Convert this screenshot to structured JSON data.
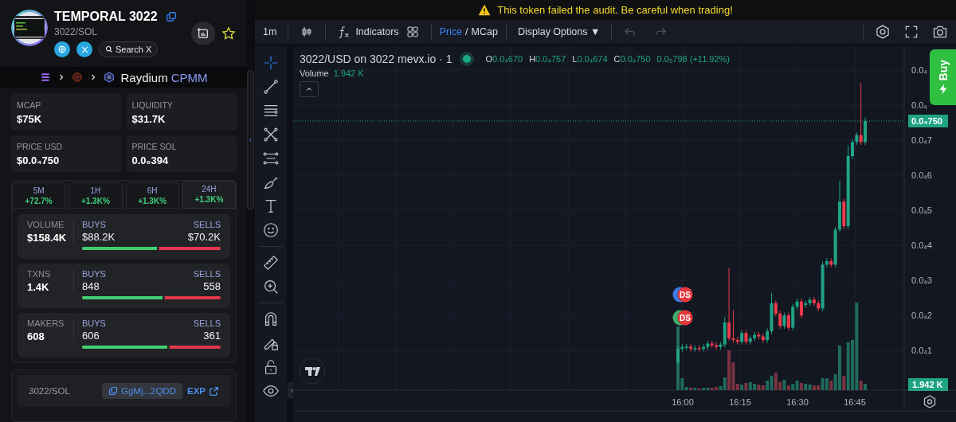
{
  "token": {
    "name": "TEMPORAL 3022",
    "pair": "3022/SOL",
    "search_label": "Search X"
  },
  "breadcrumb": {
    "dex": "Raydium",
    "pool_type": "CPMM"
  },
  "stats": [
    {
      "label": "MCAP",
      "value": "$75K"
    },
    {
      "label": "LIQUIDITY",
      "value": "$31.7K"
    },
    {
      "label": "PRICE USD",
      "value": "$0.0₄750"
    },
    {
      "label": "PRICE SOL",
      "value": "0.0₆394"
    }
  ],
  "timeframes": [
    {
      "label": "5M",
      "change": "+72.7%",
      "selected": false
    },
    {
      "label": "1H",
      "change": "+1.3K%",
      "selected": false
    },
    {
      "label": "6H",
      "change": "+1.3K%",
      "selected": false
    },
    {
      "label": "24H",
      "change": "+1.3K%",
      "selected": true
    }
  ],
  "activity": [
    {
      "label": "VOLUME",
      "total": "$158.4K",
      "buys_label": "BUYS",
      "buys": "$88.2K",
      "sells_label": "SELLS",
      "sells": "$70.2K",
      "level": 0.56
    },
    {
      "label": "TXNS",
      "total": "1.4K",
      "buys_label": "BUYS",
      "buys": "848",
      "sells_label": "SELLS",
      "sells": "558",
      "level": 0.6
    },
    {
      "label": "MAKERS",
      "total": "608",
      "buys_label": "BUYS",
      "buys": "606",
      "sells_label": "SELLS",
      "sells": "361",
      "level": 0.63
    }
  ],
  "pool": {
    "pair": "3022/SOL",
    "address": "GgMj...2QDD",
    "explorer": "EXP"
  },
  "banner": {
    "message": "This token failed the audit. Be careful when trading!"
  },
  "toolbar": {
    "interval": "1m",
    "indicators": "Indicators",
    "price_mode": [
      {
        "label": "Price",
        "selected": true
      },
      {
        "label": "MCap",
        "selected": false
      }
    ],
    "separator": "/",
    "display_options": "Display Options ▼",
    "undo": {
      "disabled": true
    },
    "redo": {
      "disabled": true
    }
  },
  "tools": [
    {
      "kind": "crosshair",
      "selected": true
    },
    {
      "kind": "trend_line",
      "selected": false
    },
    {
      "kind": "fib",
      "selected": false
    },
    {
      "kind": "pattern",
      "selected": false
    },
    {
      "kind": "projection",
      "selected": false
    },
    {
      "kind": "brush",
      "selected": false
    },
    {
      "kind": "text",
      "selected": false
    },
    {
      "kind": "emoji",
      "selected": false
    },
    {
      "kind": "ruler",
      "selected": false
    },
    {
      "kind": "zoom",
      "selected": false
    },
    {
      "kind": "magnet",
      "selected": false
    },
    {
      "kind": "lock_drawing",
      "selected": false
    },
    {
      "kind": "lock",
      "selected": false
    },
    {
      "kind": "eye",
      "selected": false
    }
  ],
  "legend": {
    "symbol": "3022/USD on 3022 mevx.io · 1",
    "ohlc": [
      {
        "key": "O",
        "value": "0.0₄670"
      },
      {
        "key": "H",
        "value": "0.0₄757"
      },
      {
        "key": "L",
        "value": "0.0₄674"
      },
      {
        "key": "C",
        "value": "0.0₄750"
      }
    ],
    "change": "0.0₅798 (+11.92%)",
    "volume_label": "Volume",
    "volume": "1.942 K"
  },
  "price_axis": {
    "labels": [
      "0.0₄",
      "0.0₄",
      "0.0₄7",
      "0.0₄6",
      "0.0₄5",
      "0.0₄4",
      "0.0₄3",
      "0.0₄2",
      "0.0₄1"
    ],
    "last_price": "0.0₄750",
    "last_volume": "1.942 K"
  },
  "time_axis": [
    "16:00",
    "16:15",
    "16:30",
    "16:45"
  ],
  "markers": [
    {
      "label": "DS",
      "color": "#e8383d",
      "under": {
        "color": "#3b7de8"
      }
    },
    {
      "label": "DS",
      "color": "#e8383d",
      "under": {
        "color": "#3fae6a"
      }
    }
  ],
  "buy_button": "Buy"
}
